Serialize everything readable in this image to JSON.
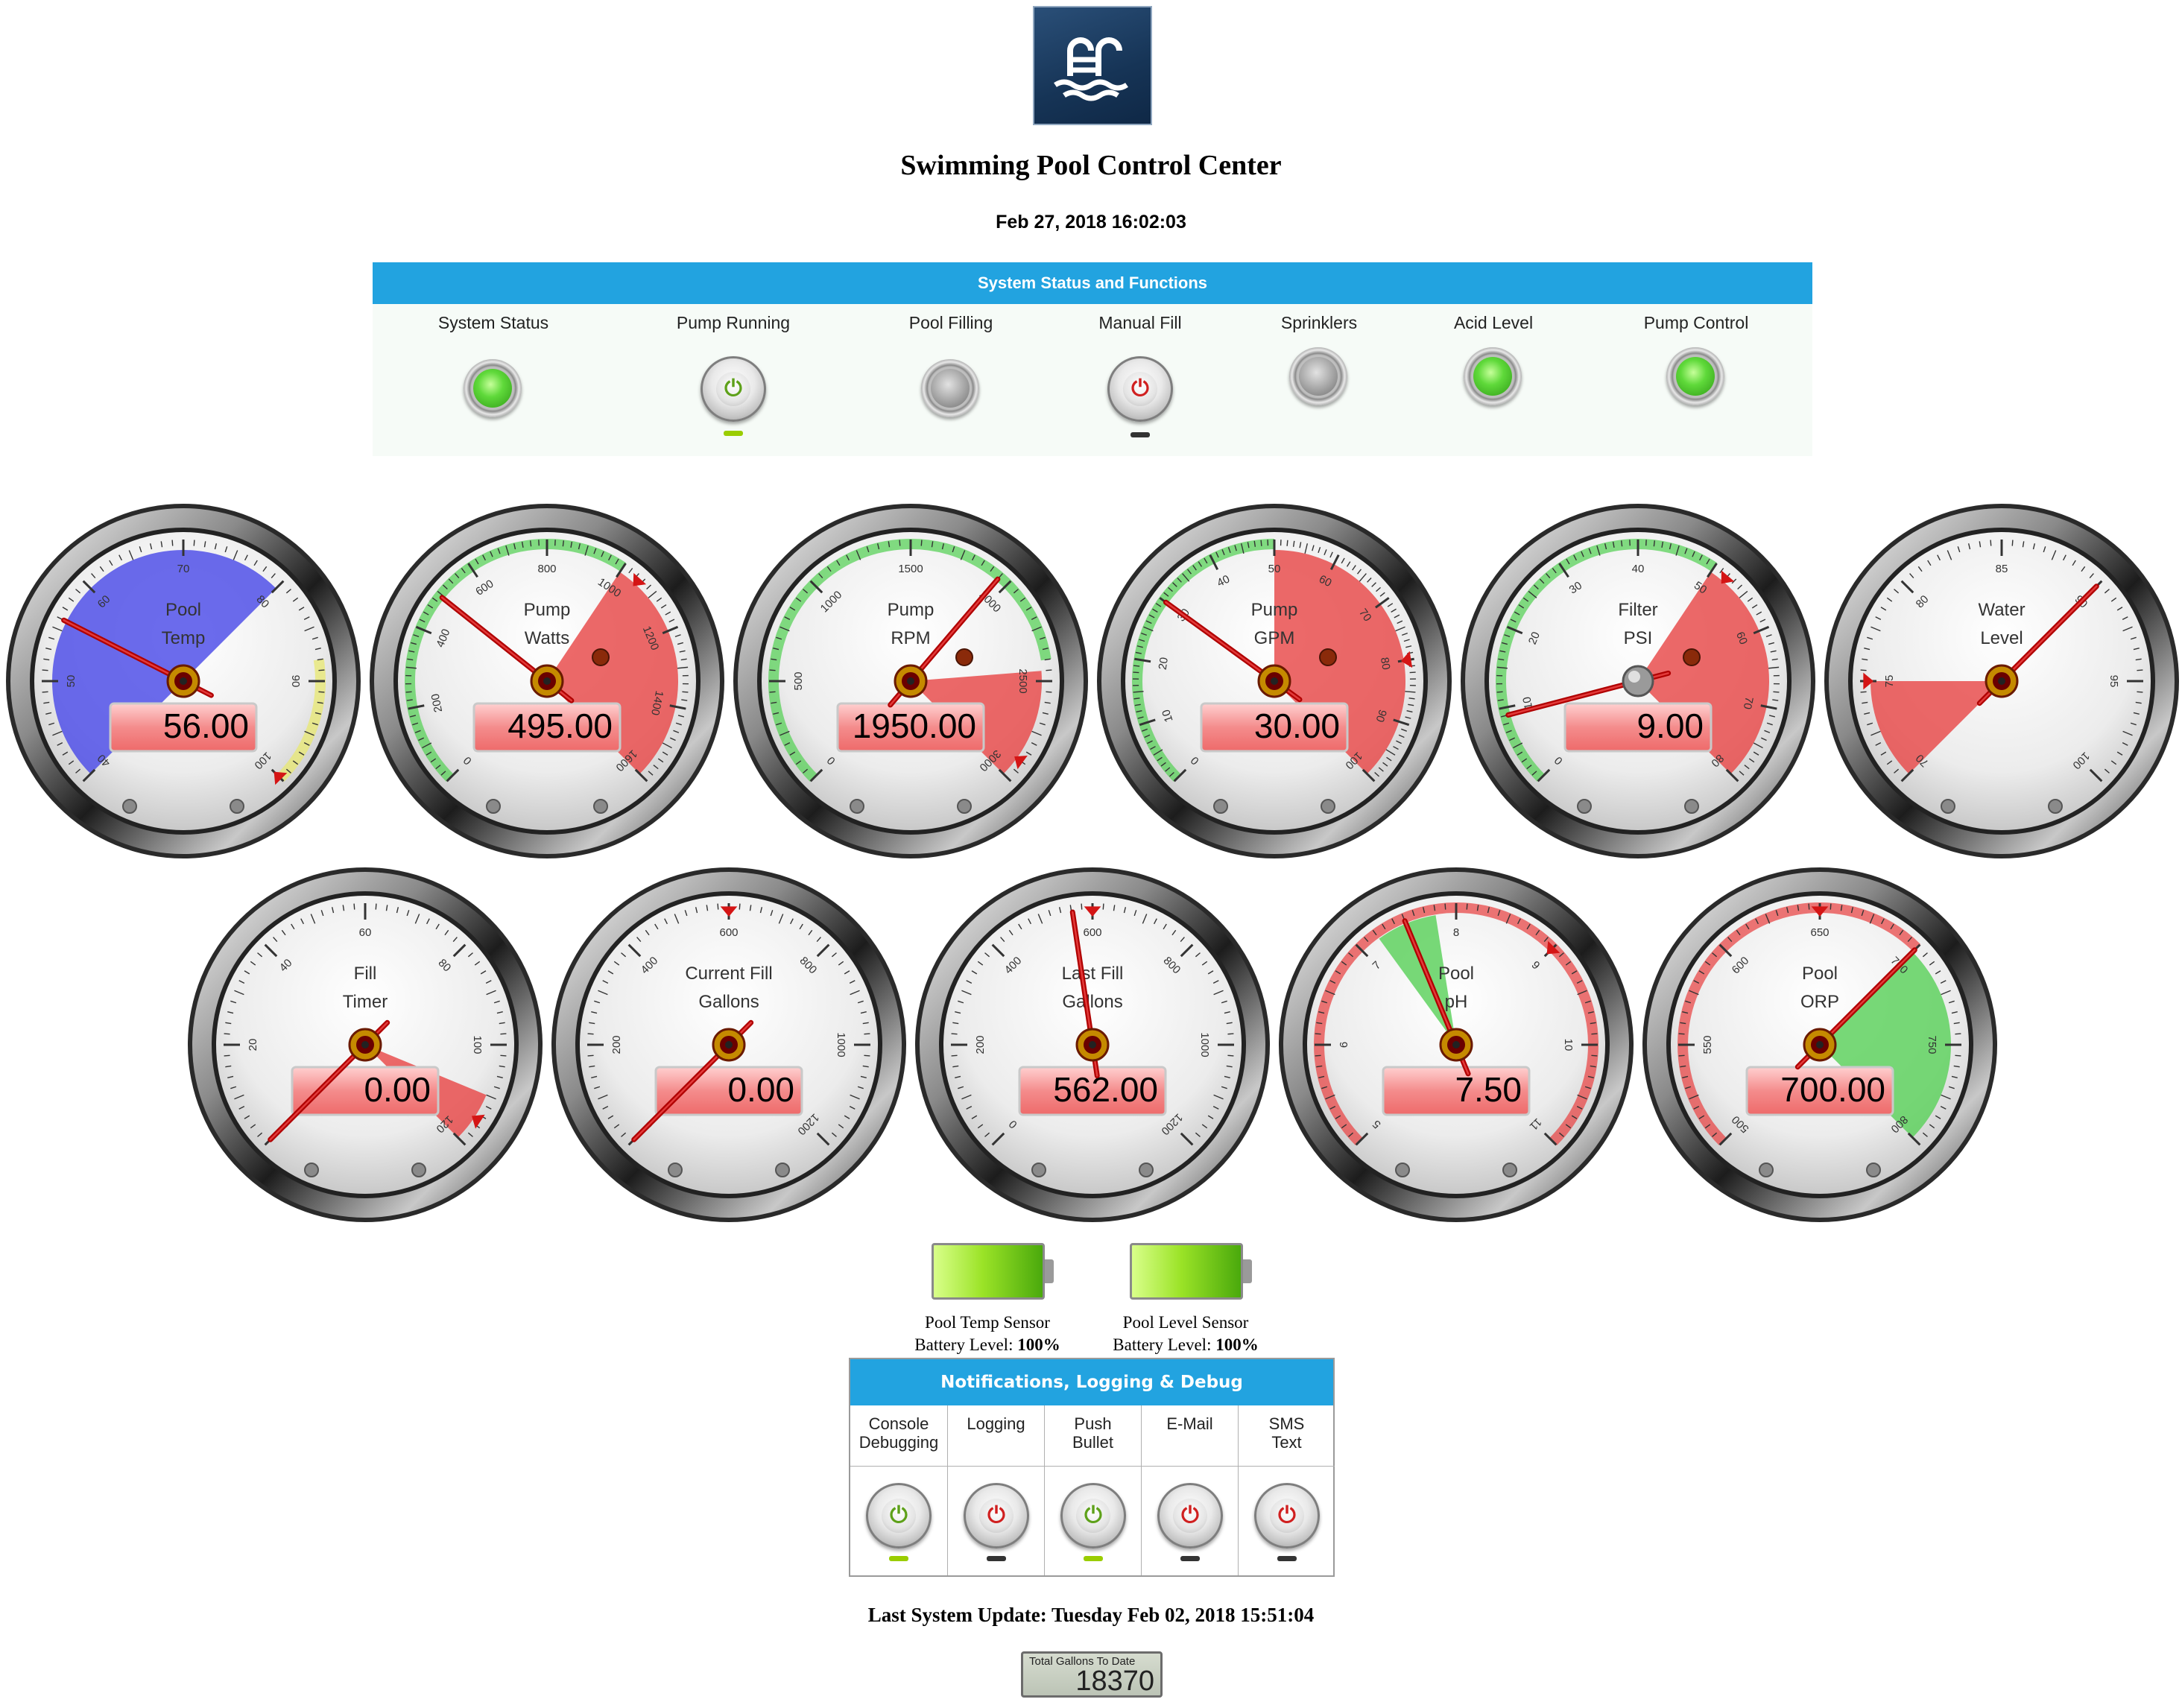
{
  "header": {
    "title": "Swimming Pool Control Center",
    "datetime": "Feb 27, 2018 16:02:03"
  },
  "status_panel": {
    "title": "System Status and Functions",
    "items": [
      {
        "label": "System Status",
        "type": "led",
        "state": "on"
      },
      {
        "label": "Pump Running",
        "type": "power",
        "state": "on"
      },
      {
        "label": "Pool Filling",
        "type": "led",
        "state": "off"
      },
      {
        "label": "Manual Fill",
        "type": "power",
        "state": "off"
      },
      {
        "label": "Sprinklers",
        "type": "led",
        "state": "off"
      },
      {
        "label": "Acid Level",
        "type": "led",
        "state": "on"
      },
      {
        "label": "Pump Control",
        "type": "led",
        "state": "on"
      }
    ]
  },
  "icons": {
    "logo": "swimming-pool-icon",
    "power": "power-icon"
  },
  "colors": {
    "accent": "#22a3e0",
    "red_zone": "#e84848",
    "green_zone": "#5ad15a",
    "blue_zone": "#4a4ae8",
    "yellow_zone": "#e8e870"
  },
  "gauges": [
    {
      "label": [
        "Pool",
        "Temp"
      ],
      "min": 40,
      "max": 100,
      "value": 56.0,
      "display": "56.00",
      "ticks": [
        "40",
        "50",
        "60",
        "70",
        "80",
        "90",
        "100"
      ],
      "zones": [
        {
          "from": 40,
          "to": 80,
          "color": "#4a4ae8"
        }
      ],
      "bands": [
        {
          "from": 88,
          "to": 100,
          "color": "#e8e870"
        }
      ],
      "knob": false,
      "marker": 100
    },
    {
      "label": [
        "Pump",
        "Watts"
      ],
      "min": 0,
      "max": 1600,
      "value": 495.0,
      "display": "495.00",
      "ticks": [
        "0",
        "200",
        "400",
        "600",
        "800",
        "1000",
        "1200",
        "1400",
        "1600"
      ],
      "zones": [
        {
          "from": 1000,
          "to": 1600,
          "color": "#e84848"
        }
      ],
      "bands": [
        {
          "from": 0,
          "to": 1000,
          "color": "#5ad15a"
        }
      ],
      "knob": false,
      "marker": 1050,
      "lamp": true
    },
    {
      "label": [
        "Pump",
        "RPM"
      ],
      "min": 0,
      "max": 3000,
      "value": 1950.0,
      "display": "1950.00",
      "ticks": [
        "0",
        "500",
        "1000",
        "1500",
        "2000",
        "2500",
        "3000"
      ],
      "zones": [
        {
          "from": 2450,
          "to": 3000,
          "color": "#e84848"
        }
      ],
      "bands": [
        {
          "from": 0,
          "to": 2400,
          "color": "#5ad15a"
        }
      ],
      "knob": false,
      "marker": 2900,
      "lamp": true
    },
    {
      "label": [
        "Pump",
        "GPM"
      ],
      "min": 0,
      "max": 100,
      "value": 30.0,
      "display": "30.00",
      "ticks": [
        "0",
        "10",
        "20",
        "30",
        "40",
        "50",
        "60",
        "70",
        "80",
        "90",
        "100"
      ],
      "zones": [
        {
          "from": 50,
          "to": 100,
          "color": "#e84848"
        }
      ],
      "bands": [
        {
          "from": 0,
          "to": 50,
          "color": "#5ad15a"
        }
      ],
      "knob": false,
      "marker": 80,
      "lamp": true
    },
    {
      "label": [
        "Filter",
        "PSI"
      ],
      "min": 0,
      "max": 80,
      "value": 9.0,
      "display": "9.00",
      "ticks": [
        "0",
        "10",
        "20",
        "30",
        "40",
        "50",
        "60",
        "70",
        "80"
      ],
      "zones": [
        {
          "from": 50,
          "to": 80,
          "color": "#e84848"
        }
      ],
      "bands": [
        {
          "from": 0,
          "to": 50,
          "color": "#5ad15a"
        }
      ],
      "knob": true,
      "marker": 52,
      "lamp": true
    },
    {
      "label": [
        "Water",
        "Level"
      ],
      "min": 70,
      "max": 100,
      "value": 90.0,
      "display": "",
      "ticks": [
        "70",
        "75",
        "80",
        "85",
        "90",
        "95",
        "100"
      ],
      "zones": [
        {
          "from": 70,
          "to": 75,
          "color": "#e84848"
        }
      ],
      "bands": [],
      "knob": false,
      "marker": 75
    },
    {
      "label": [
        "Fill",
        "Timer"
      ],
      "min": 0,
      "max": 120,
      "value": 0.0,
      "display": "0.00",
      "ticks": [
        "0",
        "20",
        "40",
        "60",
        "80",
        "100",
        "120"
      ],
      "zones": [
        {
          "from": 110,
          "to": 120,
          "color": "#e84848"
        }
      ],
      "bands": [],
      "knob": false,
      "marker": 115
    },
    {
      "label": [
        "Current Fill",
        "Gallons"
      ],
      "min": 0,
      "max": 1200,
      "value": 0.0,
      "display": "0.00",
      "ticks": [
        "0",
        "200",
        "400",
        "600",
        "800",
        "1000",
        "1200"
      ],
      "zones": [],
      "bands": [],
      "knob": false,
      "marker": 600
    },
    {
      "label": [
        "Last Fill",
        "Gallons"
      ],
      "min": 0,
      "max": 1200,
      "value": 562.0,
      "display": "562.00",
      "ticks": [
        "0",
        "200",
        "400",
        "600",
        "800",
        "1000",
        "1200"
      ],
      "zones": [],
      "bands": [],
      "knob": false,
      "marker": 600
    },
    {
      "label": [
        "Pool",
        "pH"
      ],
      "min": 5,
      "max": 11,
      "value": 7.5,
      "display": "7.50",
      "ticks": [
        "5",
        "6",
        "7",
        "8",
        "9",
        "10",
        "11"
      ],
      "zones": [
        {
          "from": 7.2,
          "to": 7.8,
          "color": "#5ad15a"
        }
      ],
      "bands": [
        {
          "from": 5,
          "to": 11,
          "color": "#e84848"
        }
      ],
      "knob": false,
      "marker": 9
    },
    {
      "label": [
        "Pool",
        "ORP"
      ],
      "min": 500,
      "max": 800,
      "value": 700.0,
      "display": "700.00",
      "ticks": [
        "500",
        "550",
        "600",
        "650",
        "700",
        "750",
        "800"
      ],
      "zones": [
        {
          "from": 700,
          "to": 800,
          "color": "#5ad15a"
        }
      ],
      "bands": [
        {
          "from": 500,
          "to": 700,
          "color": "#e84848"
        }
      ],
      "knob": false,
      "marker": 650
    }
  ],
  "batteries": [
    {
      "line1": "Pool Temp Sensor",
      "line2_prefix": "Battery Level: ",
      "level": "100%",
      "fraction": 1.0
    },
    {
      "line1": "Pool Level Sensor",
      "line2_prefix": "Battery Level: ",
      "level": "100%",
      "fraction": 1.0
    }
  ],
  "notifications": {
    "title": "Notifications, Logging & Debug",
    "items": [
      {
        "line1": "Console",
        "line2": "Debugging",
        "state": "on"
      },
      {
        "line1": "Logging",
        "line2": "",
        "state": "off"
      },
      {
        "line1": "Push",
        "line2": "Bullet",
        "state": "on"
      },
      {
        "line1": "E-Mail",
        "line2": "",
        "state": "off"
      },
      {
        "line1": "SMS",
        "line2": "Text",
        "state": "off"
      }
    ]
  },
  "footer": {
    "last_update": "Last System Update: Tuesday Feb 02, 2018 15:51:04",
    "counter_label": "Total Gallons To Date",
    "counter_value": "18370"
  }
}
